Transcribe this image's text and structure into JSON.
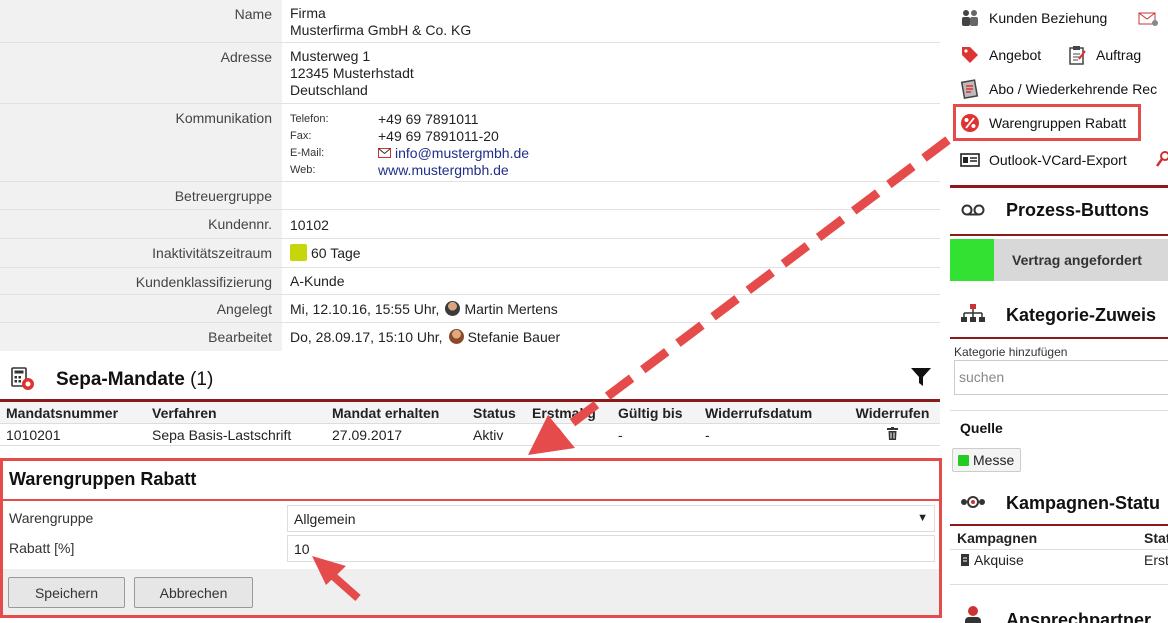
{
  "detail": {
    "name": {
      "label": "Name",
      "line1": "Firma",
      "line2": "Musterfirma GmbH & Co. KG"
    },
    "address": {
      "label": "Adresse",
      "line1": "Musterweg 1",
      "line2": "12345 Musterhstadt",
      "line3": "Deutschland"
    },
    "communication": {
      "label": "Kommunikation",
      "phone_key": "Telefon:",
      "phone": "+49 69 7891011",
      "fax_key": "Fax:",
      "fax": "+49 69 7891011-20",
      "email_key": "E-Mail:",
      "email": "info@mustergmbh.de",
      "web_key": "Web:",
      "web": "www.mustergmbh.de"
    },
    "advisor_group": {
      "label": "Betreuergruppe",
      "value": ""
    },
    "customer_no": {
      "label": "Kundennr.",
      "value": "10102"
    },
    "inactivity": {
      "label": "Inaktivitätszeitraum",
      "value": "60 Tage",
      "color": "#c6d60b"
    },
    "classification": {
      "label": "Kundenklassifizierung",
      "value": "A-Kunde"
    },
    "created": {
      "label": "Angelegt",
      "value": "Mi, 12.10.16, 15:55 Uhr,",
      "user": "Martin Mertens"
    },
    "edited": {
      "label": "Bearbeitet",
      "value": "Do, 28.09.17, 15:10 Uhr,",
      "user": "Stefanie Bauer"
    }
  },
  "sepa": {
    "title": "Sepa-Mandate",
    "count": "(1)",
    "columns": [
      "Mandatsnummer",
      "Verfahren",
      "Mandat erhalten",
      "Status",
      "Erstmalig",
      "Gültig bis",
      "Widerrufsdatum",
      "Widerrufen"
    ],
    "rows": [
      [
        "1010201",
        "Sepa Basis-Lastschrift",
        "27.09.2017",
        "Aktiv",
        "",
        "-",
        "-",
        ""
      ]
    ]
  },
  "form": {
    "title": "Warengruppen Rabatt",
    "group_label": "Warengruppe",
    "group_value": "Allgemein",
    "discount_label": "Rabatt [%]",
    "discount_value": "10",
    "save_label": "Speichern",
    "cancel_label": "Abbrechen"
  },
  "right": {
    "actions": {
      "relations": "Kunden Beziehung",
      "offer": "Angebot",
      "order": "Auftrag",
      "subscription": "Abo / Wiederkehrende Rec",
      "discount": "Warengruppen Rabatt",
      "vcard": "Outlook-VCard-Export"
    },
    "process": {
      "title": "Prozess-Buttons",
      "button": "Vertrag angefordert",
      "status_color": "#33e133"
    },
    "category": {
      "title": "Kategorie-Zuweis",
      "add_label": "Kategorie hinzufügen",
      "placeholder": "suchen"
    },
    "source": {
      "title": "Quelle",
      "tag": "Messe",
      "tag_color": "#22cc22"
    },
    "campaign": {
      "title": "Kampagnen-Statu",
      "col1": "Kampagnen",
      "col2": "Stat",
      "row_name": "Akquise",
      "row_status": "Erst"
    },
    "contacts": {
      "title": "Ansprechpartner"
    }
  },
  "colors": {
    "accent_red": "#8b1a1a",
    "highlight": "#e64b4b",
    "link": "#1f2f8a"
  }
}
